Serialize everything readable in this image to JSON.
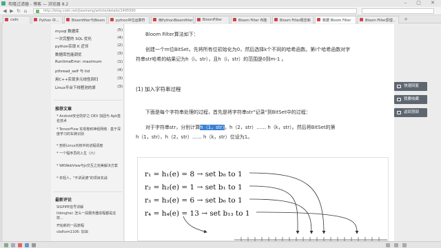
{
  "window": {
    "title": "布隆过滤器 - 博客 — 浏览器 8.2"
  },
  "address": {
    "url": "http://blog.csdn.net/jiaomeng/article/details/1495500"
  },
  "tabs": [
    {
      "label": "csdn"
    },
    {
      "label": "Python 中..."
    },
    {
      "label": "Bloomfilter与Bloom"
    },
    {
      "label": "python中位运算符"
    },
    {
      "label": "用PythonBloomfilter"
    },
    {
      "label": "BloomFilter"
    },
    {
      "label": "Bloom Filter 布隆"
    },
    {
      "label": "Bloom Filter概念和"
    },
    {
      "label": "数据 Bloom Filter"
    },
    {
      "label": "Bloom Filter原理..."
    }
  ],
  "sidebar": {
    "categories": [
      {
        "label": "mysql 数据库",
        "count": "(5)"
      },
      {
        "label": "一次完整的 SQL 优化",
        "count": "(4)"
      },
      {
        "label": "python实现 K 近邻",
        "count": "(2)"
      },
      {
        "label": "数据库性能调优",
        "count": "(3)"
      },
      {
        "label": "RuntimeError: maximum",
        "count": "(1)"
      },
      {
        "label": "pthread_self 与 tid",
        "count": "(4)"
      },
      {
        "label": "用C++实现多元线性回归",
        "count": "(3)"
      },
      {
        "label": "Linux平台下线程池的原",
        "count": "(3)"
      }
    ],
    "recommended_title": "推荐文章",
    "recommended": [
      "* Android安全防护之 DEX 加固与 Apk签名技术",
      "* TensorFlow 实现卷积神经网络 · 基于深度学习的车牌识别",
      "* 剖析Linux内核中的进程调度",
      "* 一个程序员的入生（六）",
      "* WKWebView与js交互之完美解决方案",
      "* 年轻人，\"不讲武德\"的项目实战"
    ],
    "comments_title": "最新评论",
    "comments": [
      "SIGPIPE信号详解",
      "lidonghai: 怎么一段服务器进程都是这样...",
      "开始新的一段旅程",
      "cbdhzm1106: 加油"
    ]
  },
  "article": {
    "title_line": "Bloom Filter算法如下：",
    "para1_a": "创建一个m位BitSet，先将所有位初始化为0，然后选择k个不同的哈希函数。第i个哈希函数对字",
    "para1_b": "符串str哈希的结果记为h（i，str），且h（i，str）的范围是0到m-1 。",
    "section_heading": "(1) 加入字符串过程",
    "para2": "下面是每个字符串处理的过程，首先是将字符串str\"记录\"到BitSet中的过程：",
    "para3_pre": "对于字符串str，分别计算",
    "para3_hl": "h（1，str）",
    "para3_post": "，h（2，str）……  h（k，str）。然后将BitSet的第",
    "para3_b": "h（1，str）、h（2，str）…… h（k，str）位设为1。",
    "diagram_rows": [
      "r₁ = h₁(e) = 8  →  set b₈ to 1",
      "r₂ = h₂(e) = 1  →  set b₁ to 1",
      "r₃ = h₃(e) = 6  →  set b₆ to 1",
      "r₄ = h₄(e) = 13  →  set b₁₃ to 1"
    ]
  },
  "right_panel": {
    "buttons": [
      {
        "label": "快速回复"
      },
      {
        "label": "我要收藏"
      },
      {
        "label": "返回顶部"
      }
    ]
  },
  "colors": {
    "highlight": "#3a7fd0",
    "button_bg": "#5e6670"
  }
}
